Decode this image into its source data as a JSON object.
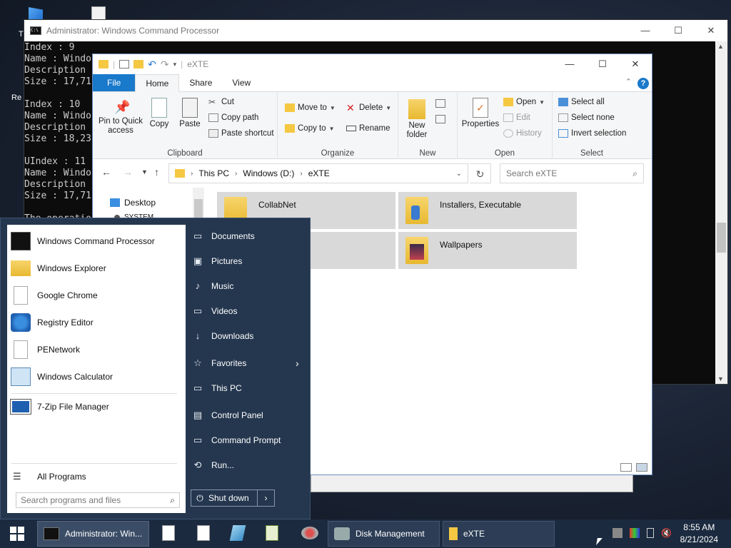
{
  "desktop": {
    "label_fragment_1": "T",
    "label_fragment_2": "Re"
  },
  "cmd": {
    "title": "Administrator: Windows Command Processor",
    "icon_text": "C:\\",
    "lines": [
      "Index : 9",
      "Name : Windo",
      "Description",
      "Size : 17,71",
      "",
      "Index : 10",
      "Name : Windo",
      "Description",
      "Size : 18,23",
      "",
      "UIndex : 11",
      "Name : Windo",
      "Description",
      "Size : 17,71",
      "",
      "The operatio"
    ],
    "btn_min": "—",
    "btn_max": "☐",
    "btn_close": "✕"
  },
  "explorer": {
    "title": "eXTE",
    "tabs": {
      "file": "File",
      "home": "Home",
      "share": "Share",
      "view": "View"
    },
    "clipboard": {
      "pin": "Pin to Quick access",
      "copy": "Copy",
      "paste": "Paste",
      "cut": "Cut",
      "copy_path": "Copy path",
      "paste_shortcut": "Paste shortcut",
      "label": "Clipboard"
    },
    "organize": {
      "move_to": "Move to",
      "copy_to": "Copy to",
      "delete": "Delete",
      "rename": "Rename",
      "label": "Organize"
    },
    "new": {
      "new_folder": "New folder",
      "label": "New"
    },
    "open": {
      "properties": "Properties",
      "open": "Open",
      "edit": "Edit",
      "history": "History",
      "label": "Open"
    },
    "select": {
      "select_all": "Select all",
      "select_none": "Select none",
      "invert": "Invert selection",
      "label": "Select"
    },
    "address": [
      "This PC",
      "Windows (D:)",
      "eXTE"
    ],
    "search_placeholder": "Search eXTE",
    "nav": [
      "Desktop",
      "SYSTEM"
    ],
    "items": [
      "CollabNet",
      "Installers, Executable",
      "Wallpapers"
    ]
  },
  "start_menu": {
    "left_items": [
      "Windows Command Processor",
      "Windows Explorer",
      "Google Chrome",
      "Registry Editor",
      "PENetwork",
      "Windows Calculator",
      "7-Zip File Manager"
    ],
    "all_programs": "All Programs",
    "search_placeholder": "Search programs and files",
    "right_items": [
      "Documents",
      "Pictures",
      "Music",
      "Videos",
      "Downloads",
      "Favorites",
      "This PC",
      "Control Panel",
      "Command Prompt",
      "Run..."
    ],
    "shutdown": "Shut down"
  },
  "taskbar": {
    "buttons": [
      "Administrator: Win...",
      "Disk Management",
      "eXTE"
    ],
    "time": "8:55 AM",
    "date": "8/21/2024"
  },
  "colors": {
    "start_bg": "#25374f",
    "taskbar_bg": "#1b2a3f",
    "file_tab": "#1979ca",
    "folder": "#f5c842"
  }
}
